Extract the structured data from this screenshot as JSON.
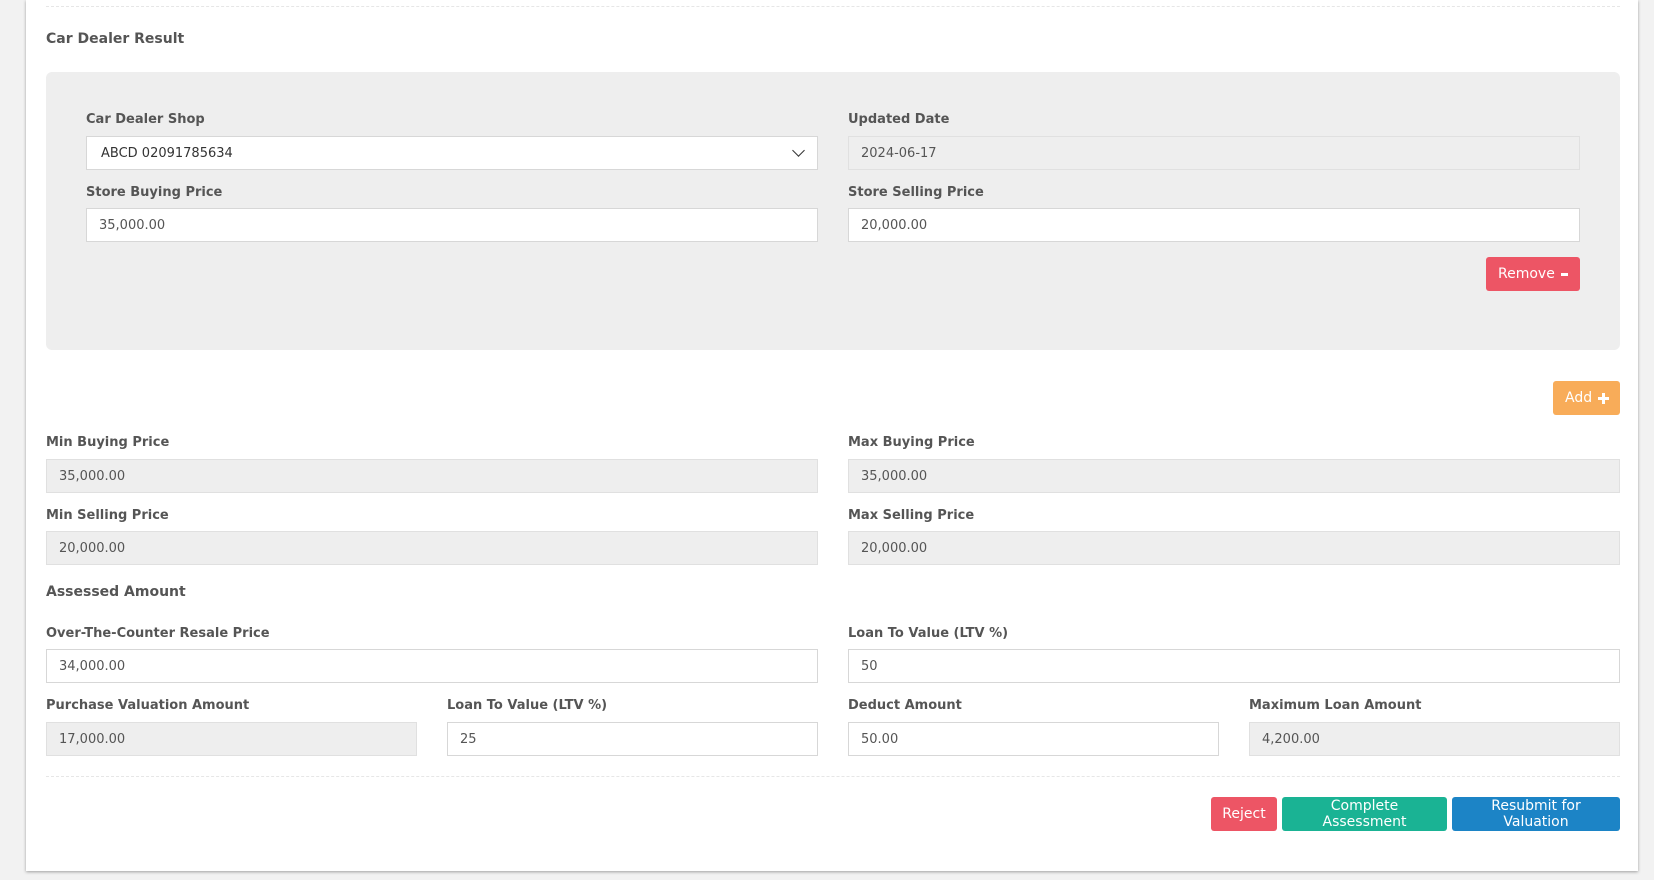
{
  "dealer_section": {
    "title": "Car Dealer Result",
    "shop_label": "Car Dealer Shop",
    "shop_value": "ABCD 02091785634",
    "updated_date_label": "Updated Date",
    "updated_date_value": "2024-06-17",
    "store_buying_label": "Store Buying Price",
    "store_buying_value": "35,000.00",
    "store_selling_label": "Store Selling Price",
    "store_selling_value": "20,000.00",
    "remove_label": "Remove",
    "add_label": "Add"
  },
  "price_range": {
    "min_buying_label": "Min Buying Price",
    "min_buying_value": "35,000.00",
    "max_buying_label": "Max Buying Price",
    "max_buying_value": "35,000.00",
    "min_selling_label": "Min Selling Price",
    "min_selling_value": "20,000.00",
    "max_selling_label": "Max Selling Price",
    "max_selling_value": "20,000.00"
  },
  "assessed": {
    "title": "Assessed Amount",
    "otc_label": "Over-The-Counter Resale Price",
    "otc_value": "34,000.00",
    "ltv_label": "Loan To Value (LTV %)",
    "ltv_value": "50",
    "purchase_label": "Purchase Valuation Amount",
    "purchase_value": "17,000.00",
    "ltv2_label": "Loan To Value (LTV %)",
    "ltv2_value": "25",
    "deduct_label": "Deduct Amount",
    "deduct_value": "50.00",
    "max_loan_label": "Maximum Loan Amount",
    "max_loan_value": "4,200.00"
  },
  "actions": {
    "reject": "Reject",
    "complete": "Complete Assessment",
    "resubmit": "Resubmit for Valuation"
  },
  "colors": {
    "danger": "#ed5565",
    "warning": "#f8ac59",
    "success": "#1ab394",
    "primary": "#1c84c6"
  }
}
